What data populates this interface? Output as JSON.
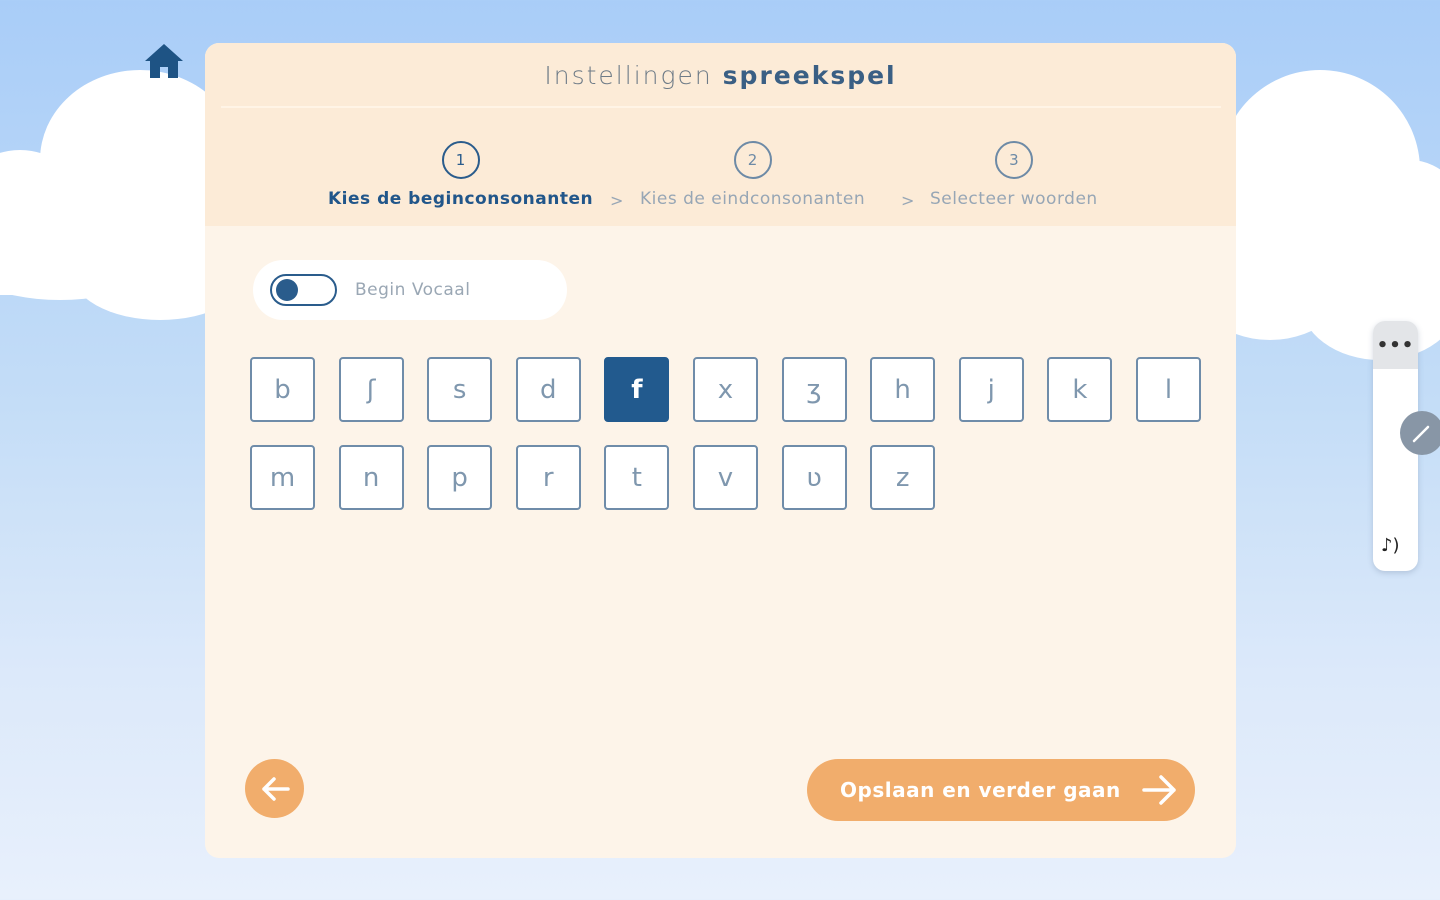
{
  "title": {
    "light": "Instellingen",
    "bold": "spreekspel"
  },
  "steps": [
    {
      "number": "1",
      "label": "Kies de beginconsonanten",
      "active": true
    },
    {
      "number": "2",
      "label": "Kies de eindconsonanten",
      "active": false
    },
    {
      "number": "3",
      "label": "Selecteer woorden",
      "active": false
    }
  ],
  "step_separator": ">",
  "toggle": {
    "label": "Begin Vocaal",
    "on": false
  },
  "letters": [
    "b",
    "ʃ",
    "s",
    "d",
    "f",
    "x",
    "ʒ",
    "h",
    "j",
    "k",
    "l",
    "m",
    "n",
    "p",
    "r",
    "t",
    "v",
    "ʋ",
    "z"
  ],
  "selected_letters": [
    "f"
  ],
  "buttons": {
    "next_label": "Opslaan en verder gaan"
  },
  "side_widget": {
    "menu_label": "•••",
    "music_label": "♪)"
  },
  "colors": {
    "primary": "#225a8e",
    "accent_orange": "#f1ad6c",
    "panel_bg": "#fdf4e9",
    "header_bg": "#fcebd7"
  },
  "icons": [
    "home-icon",
    "arrow-left-icon",
    "arrow-right-icon",
    "pencil-icon",
    "more-dots-icon",
    "music-note-icon"
  ]
}
